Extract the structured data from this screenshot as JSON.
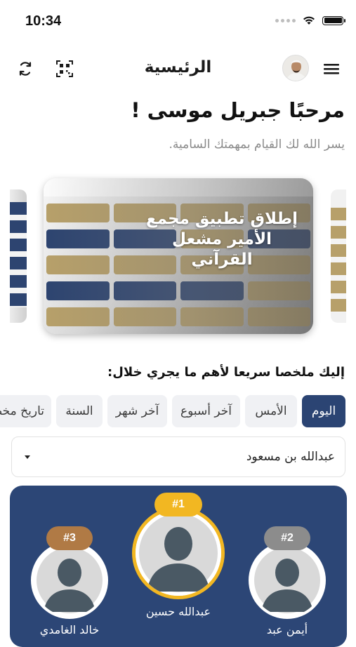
{
  "status_bar": {
    "time": "10:34"
  },
  "header": {
    "title": "الرئيسية"
  },
  "welcome": {
    "greeting": "مرحبًا جبريل موسى  !",
    "subtitle": "يسر الله لك القيام بمهمتك السامية."
  },
  "banner": {
    "caption": "إطلاق تطبيق مجمع الأمير مشعل القرآني"
  },
  "summary": {
    "label": "إليك ملخصا سريعا لأهم ما يجري خلال:",
    "tabs": [
      "اليوم",
      "الأمس",
      "آخر أسبوع",
      "آخر شهر",
      "السنة",
      "تاريخ مخصص"
    ],
    "active_tab": 0
  },
  "filter": {
    "selected": "عبدالله بن مسعود"
  },
  "leaderboard": {
    "first": {
      "rank": "#1",
      "name": "عبدالله حسين"
    },
    "second": {
      "rank": "#2",
      "name": "أيمن عبد"
    },
    "third": {
      "rank": "#3",
      "name": "خالد الغامدي"
    }
  },
  "colors": {
    "primary_navy": "#2b4473",
    "gold_badge": "#f2b722",
    "silver_badge": "#8c8c8c",
    "bronze_badge": "#b07a45"
  }
}
